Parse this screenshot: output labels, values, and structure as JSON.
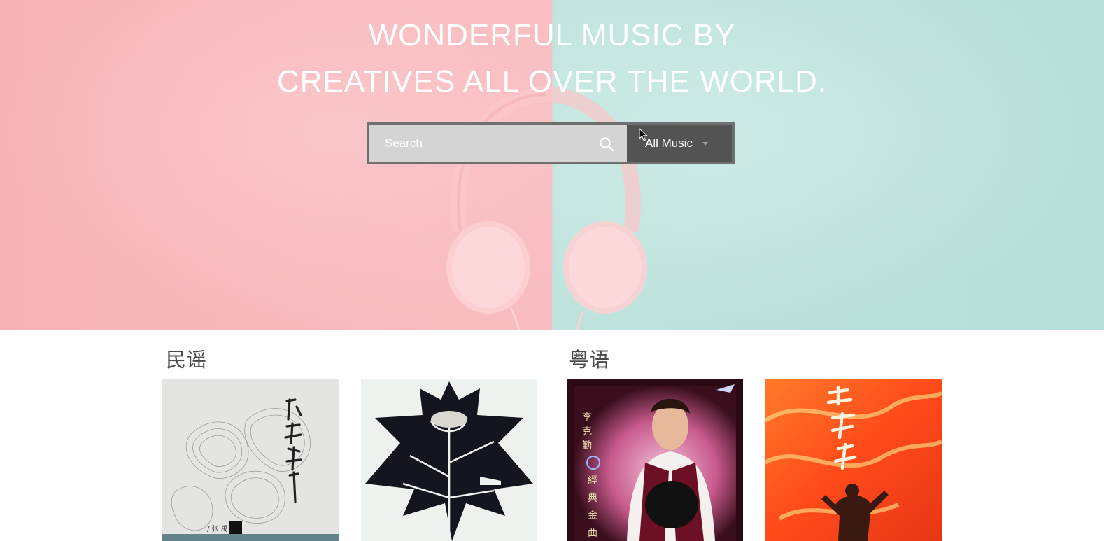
{
  "hero": {
    "title_line1": "WONDERFUL MUSIC BY",
    "title_line2": "CREATIVES ALL OVER THE WORLD."
  },
  "search": {
    "placeholder": "Search",
    "category_selected": "All Music",
    "icon": "search-icon"
  },
  "sections": [
    {
      "title": "民谣",
      "albums": [
        "album-cover-sketch",
        "album-cover-leaf"
      ]
    },
    {
      "title": "粤语",
      "albums": [
        "album-cover-portrait",
        "album-cover-fire"
      ]
    }
  ],
  "colors": {
    "hero_pink": "#f6b3b7",
    "hero_teal": "#bfe3dd",
    "search_field": "#d4d4d4",
    "select_bg": "#535353"
  }
}
